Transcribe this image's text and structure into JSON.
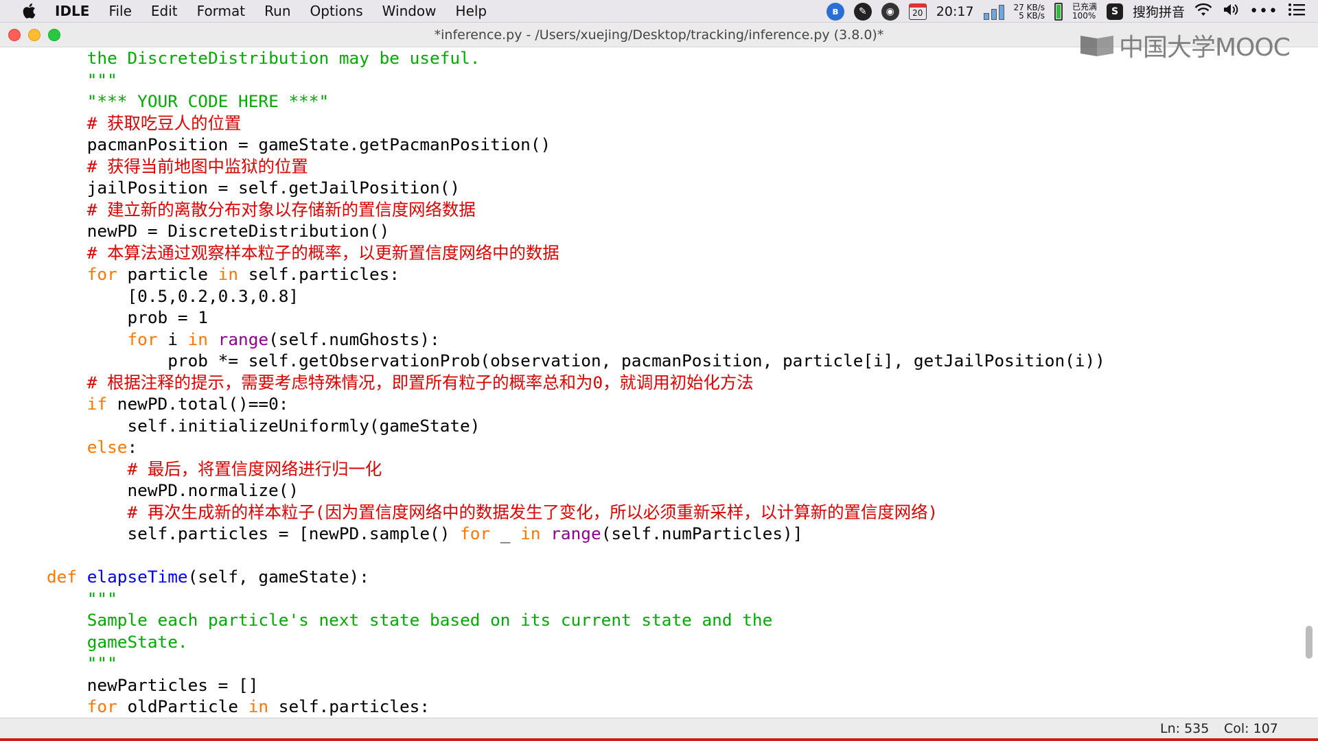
{
  "menubar": {
    "app": "IDLE",
    "items": [
      "File",
      "Edit",
      "Format",
      "Run",
      "Options",
      "Window",
      "Help"
    ],
    "status": {
      "calendar_day": "20",
      "time": "20:17",
      "net_up": "27 KB/s",
      "net_down": "5 KB/s",
      "battery_label": "已充满",
      "battery_percent": "100%",
      "ime": "搜狗拼音"
    }
  },
  "window": {
    "title": "*inference.py - /Users/xuejing/Desktop/tracking/inference.py (3.8.0)*"
  },
  "watermark": {
    "text": "中国大学MOOC"
  },
  "editor": {
    "lines": [
      [
        {
          "t": "    "
        },
        {
          "t": "the DiscreteDistribution may be useful.",
          "c": "st"
        }
      ],
      [
        {
          "t": "    "
        },
        {
          "t": "\"\"\"",
          "c": "st"
        }
      ],
      [
        {
          "t": "    "
        },
        {
          "t": "\"*** YOUR CODE HERE ***\"",
          "c": "st"
        }
      ],
      [
        {
          "t": "    "
        },
        {
          "t": "# 获取吃豆人的位置",
          "c": "cm"
        }
      ],
      [
        {
          "t": "    pacmanPosition = gameState.getPacmanPosition()"
        }
      ],
      [
        {
          "t": "    "
        },
        {
          "t": "# 获得当前地图中监狱的位置",
          "c": "cm"
        }
      ],
      [
        {
          "t": "    jailPosition = self.getJailPosition()"
        }
      ],
      [
        {
          "t": "    "
        },
        {
          "t": "# 建立新的离散分布对象以存储新的置信度网络数据",
          "c": "cm"
        }
      ],
      [
        {
          "t": "    newPD = DiscreteDistribution()"
        }
      ],
      [
        {
          "t": "    "
        },
        {
          "t": "# 本算法通过观察样本粒子的概率，以更新置信度网络中的数据",
          "c": "cm"
        }
      ],
      [
        {
          "t": "    "
        },
        {
          "t": "for",
          "c": "kw"
        },
        {
          "t": " particle "
        },
        {
          "t": "in",
          "c": "kw"
        },
        {
          "t": " self.particles:"
        }
      ],
      [
        {
          "t": "        [0.5,0.2,0.3,0.8]"
        }
      ],
      [
        {
          "t": "        prob = 1"
        }
      ],
      [
        {
          "t": "        "
        },
        {
          "t": "for",
          "c": "kw"
        },
        {
          "t": " i "
        },
        {
          "t": "in",
          "c": "kw"
        },
        {
          "t": " "
        },
        {
          "t": "range",
          "c": "bi"
        },
        {
          "t": "(self.numGhosts):"
        }
      ],
      [
        {
          "t": "            prob *= self.getObservationProb(observation, pacmanPosition, particle[i], getJailPosition(i))"
        }
      ],
      [
        {
          "t": "    "
        },
        {
          "t": "# 根据注释的提示，需要考虑特殊情况，即置所有粒子的概率总和为0，就调用初始化方法",
          "c": "cm"
        }
      ],
      [
        {
          "t": "    "
        },
        {
          "t": "if",
          "c": "kw"
        },
        {
          "t": " newPD.total()==0:"
        }
      ],
      [
        {
          "t": "        self.initializeUniformly(gameState)"
        }
      ],
      [
        {
          "t": "    "
        },
        {
          "t": "else",
          "c": "kw"
        },
        {
          "t": ":"
        }
      ],
      [
        {
          "t": "        "
        },
        {
          "t": "# 最后，将置信度网络进行归一化",
          "c": "cm"
        }
      ],
      [
        {
          "t": "        newPD.normalize()"
        }
      ],
      [
        {
          "t": "        "
        },
        {
          "t": "# 再次生成新的样本粒子(因为置信度网络中的数据发生了变化，所以必须重新采样，以计算新的置信度网络)",
          "c": "cm"
        }
      ],
      [
        {
          "t": "        self.particles = [newPD.sample() "
        },
        {
          "t": "for",
          "c": "kw"
        },
        {
          "t": " _ "
        },
        {
          "t": "in",
          "c": "kw"
        },
        {
          "t": " "
        },
        {
          "t": "range",
          "c": "bi"
        },
        {
          "t": "(self.numParticles)]"
        }
      ],
      [
        {
          "t": ""
        }
      ],
      [
        {
          "t": ""
        },
        {
          "t": "def",
          "c": "kw"
        },
        {
          "t": " "
        },
        {
          "t": "elapseTime",
          "c": "fn"
        },
        {
          "t": "(self, gameState):"
        }
      ],
      [
        {
          "t": "    "
        },
        {
          "t": "\"\"\"",
          "c": "st"
        }
      ],
      [
        {
          "t": "    "
        },
        {
          "t": "Sample each particle's next state based on its current state and the",
          "c": "st"
        }
      ],
      [
        {
          "t": "    "
        },
        {
          "t": "gameState.",
          "c": "st"
        }
      ],
      [
        {
          "t": "    "
        },
        {
          "t": "\"\"\"",
          "c": "st"
        }
      ],
      [
        {
          "t": "    newParticles = []"
        }
      ],
      [
        {
          "t": "    "
        },
        {
          "t": "for",
          "c": "kw"
        },
        {
          "t": " oldParticle "
        },
        {
          "t": "in",
          "c": "kw"
        },
        {
          "t": " self.particles:"
        }
      ]
    ]
  },
  "statusbar": {
    "ln": "Ln: 535",
    "col": "Col: 107"
  }
}
